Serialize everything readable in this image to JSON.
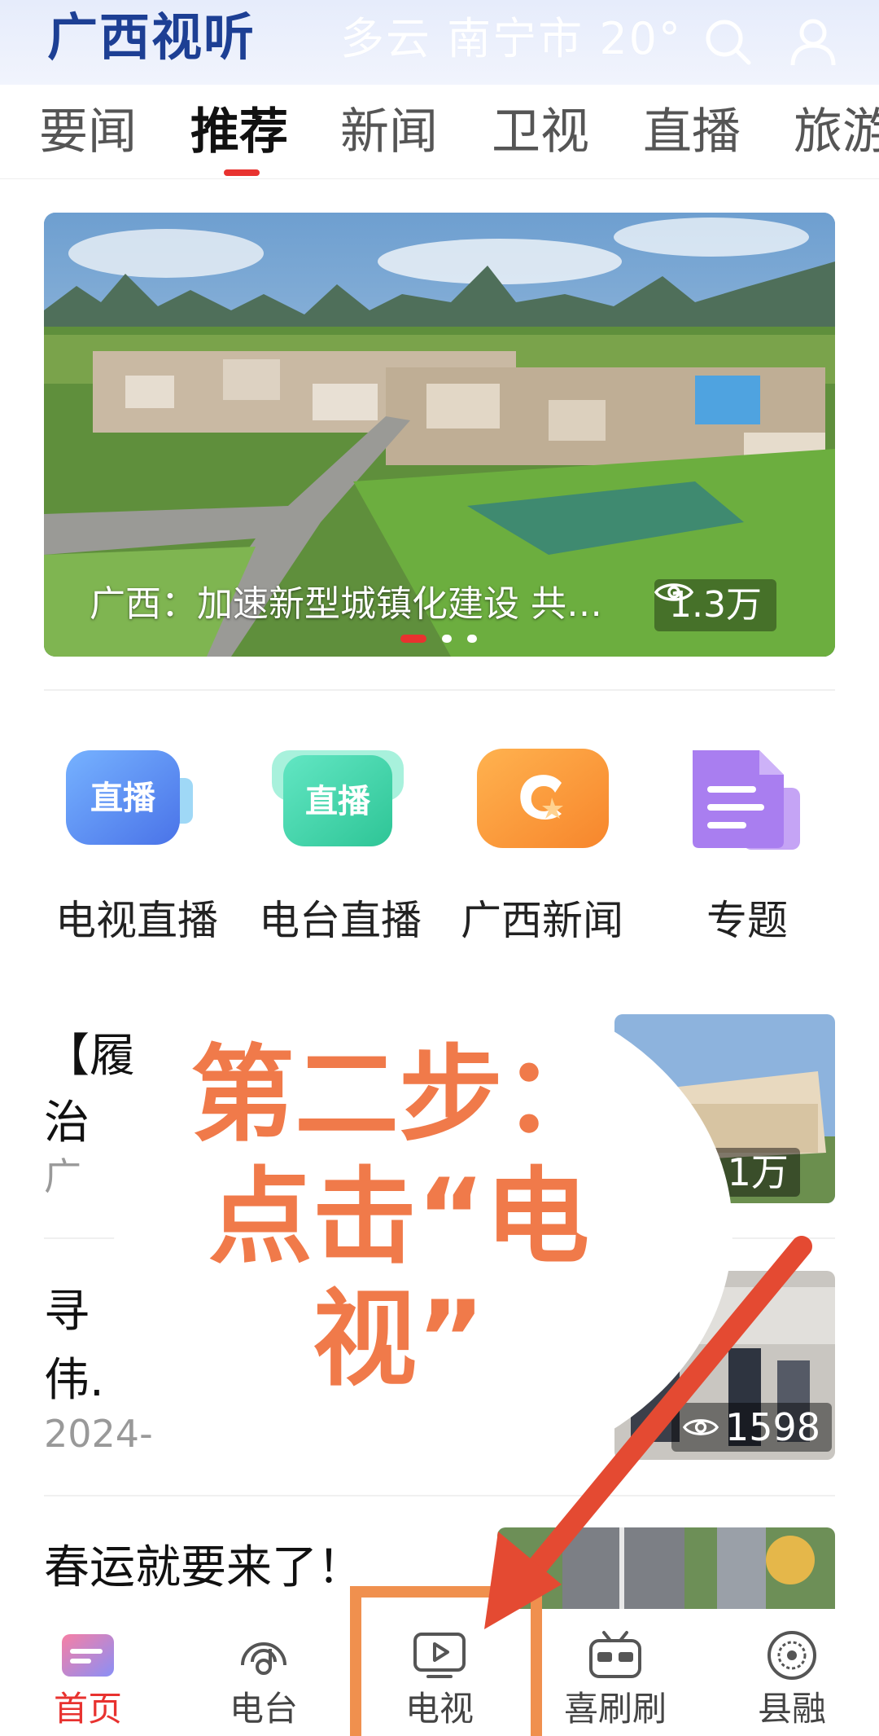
{
  "header": {
    "logo": "广西视听",
    "weather": "多云 南宁市 20°",
    "search_icon": "search-icon",
    "user_icon": "user-icon"
  },
  "tabs": [
    {
      "label": "要闻",
      "active": false
    },
    {
      "label": "推荐",
      "active": true
    },
    {
      "label": "新闻",
      "active": false
    },
    {
      "label": "卫视",
      "active": false
    },
    {
      "label": "直播",
      "active": false
    },
    {
      "label": "旅游",
      "active": false
    }
  ],
  "banner": {
    "caption": "广西：加速新型城镇化建设 共…",
    "views": "1.3万",
    "page_count": 3,
    "active_page": 1
  },
  "quick_entries": [
    {
      "label": "电视直播",
      "icon": "tv-live-icon",
      "icon_text": "直播",
      "color": "#5b8ff2"
    },
    {
      "label": "电台直播",
      "icon": "radio-live-icon",
      "icon_text": "直播",
      "color": "#3fcfa4"
    },
    {
      "label": "广西新闻",
      "icon": "guangxi-news-icon",
      "color": "#f7933a"
    },
    {
      "label": "专题",
      "icon": "special-topic-icon",
      "color": "#a77be8"
    }
  ],
  "news": [
    {
      "title_line1": "【履",
      "title_line2": "治",
      "meta": "广",
      "views": ".1万"
    },
    {
      "title_line1": "寻",
      "title_line2": "伟.",
      "meta": "2024-",
      "views": "1598"
    },
    {
      "title_line1": "春运就要来了！"
    }
  ],
  "overlay": {
    "line1": "第二步：",
    "line2": "点击“电",
    "line3": "视”",
    "color": "#f07a4a"
  },
  "bottom_nav": [
    {
      "label": "首页",
      "icon": "home-icon",
      "active": true
    },
    {
      "label": "电台",
      "icon": "radio-icon",
      "active": false
    },
    {
      "label": "电视",
      "icon": "tv-icon",
      "active": false
    },
    {
      "label": "喜刷刷",
      "icon": "xishuashua-icon",
      "active": false
    },
    {
      "label": "县融",
      "icon": "county-media-icon",
      "active": false
    }
  ],
  "colors": {
    "accent_red": "#e8322f",
    "logo_blue": "#1d3f94",
    "highlight_orange": "#f0904e",
    "arrow_red": "#e44a32"
  }
}
